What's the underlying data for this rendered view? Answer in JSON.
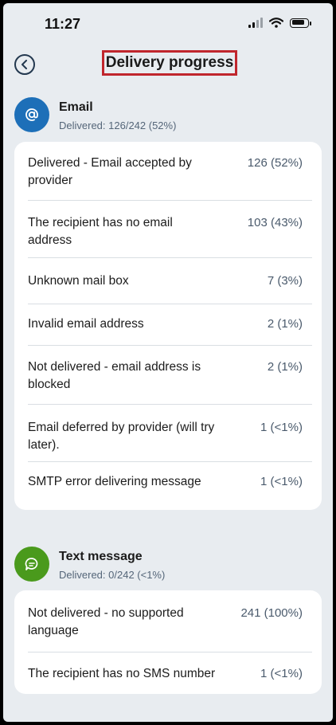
{
  "status_bar": {
    "time": "11:27"
  },
  "header": {
    "title": "Delivery progress"
  },
  "email": {
    "title": "Email",
    "subtitle": "Delivered: 126/242 (52%)",
    "color": "#1d6fb8",
    "icon": "at-sign-icon",
    "rows": [
      {
        "label": "Delivered - Email accepted by provider",
        "value": "126 (52%)"
      },
      {
        "label": "The recipient has no email address",
        "value": "103 (43%)"
      },
      {
        "label": "Unknown mail box",
        "value": "7 (3%)"
      },
      {
        "label": "Invalid email address",
        "value": "2 (1%)"
      },
      {
        "label": "Not delivered - email address is blocked",
        "value": "2 (1%)"
      },
      {
        "label": "Email deferred by provider (will try later).",
        "value": "1 (<1%)"
      },
      {
        "label": "SMTP error delivering message",
        "value": "1 (<1%)"
      }
    ]
  },
  "sms": {
    "title": "Text message",
    "subtitle": "Delivered: 0/242 (<1%)",
    "color": "#4a9a1c",
    "icon": "chat-bubble-icon",
    "rows": [
      {
        "label": "Not delivered - no supported language",
        "value": "241 (100%)"
      },
      {
        "label": "The recipient has no SMS number",
        "value": "1 (<1%)"
      }
    ]
  }
}
